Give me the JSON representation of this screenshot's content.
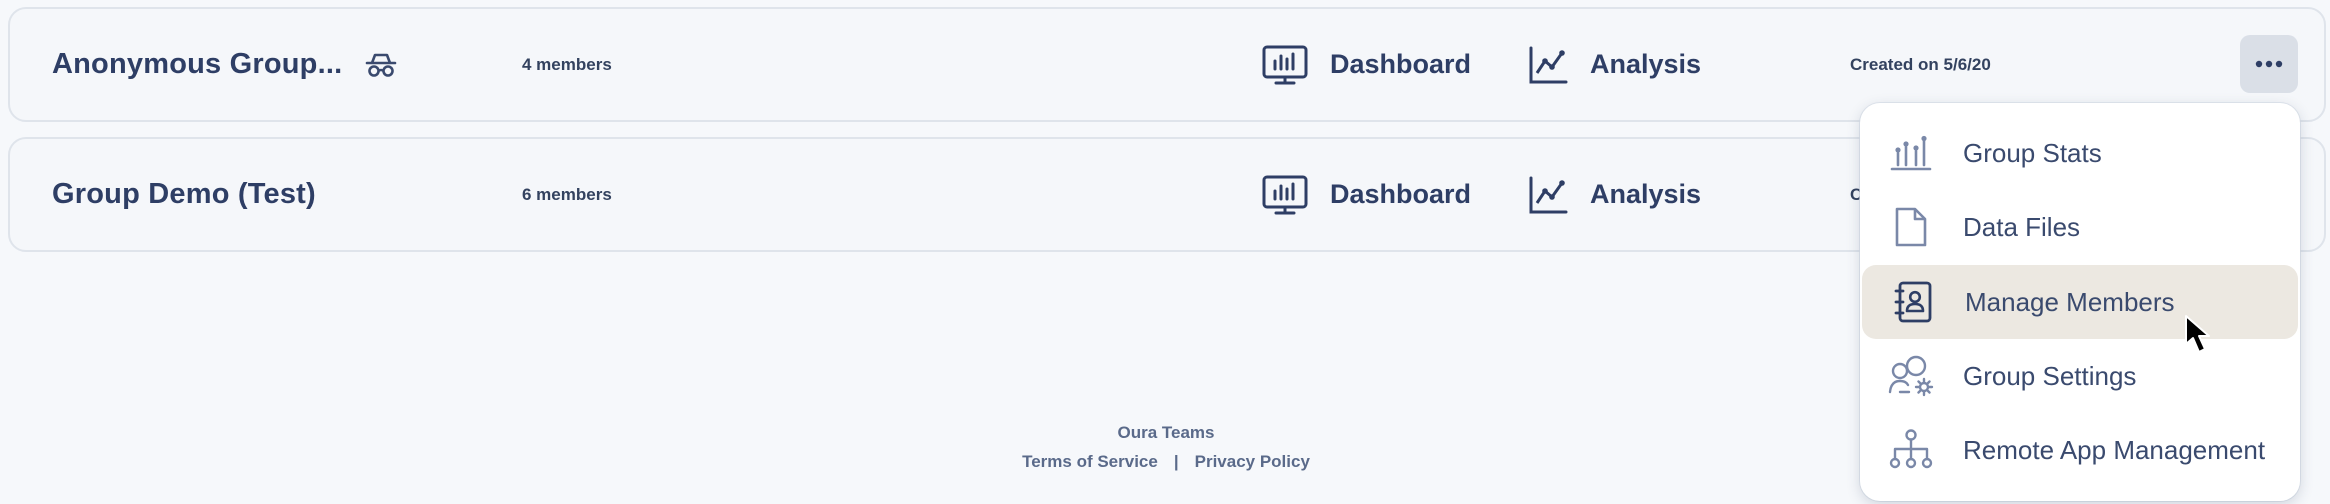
{
  "groups": [
    {
      "name": "Anonymous Group...",
      "icon": "incognito-icon",
      "members": "4 members",
      "dashboard_label": "Dashboard",
      "analysis_label": "Analysis",
      "created": "Created on 5/6/20"
    },
    {
      "name": "Group Demo (Test)",
      "members": "6 members",
      "dashboard_label": "Dashboard",
      "analysis_label": "Analysis",
      "created": "C"
    }
  ],
  "menu": {
    "items": [
      {
        "label": "Group Stats",
        "icon": "group-stats-icon"
      },
      {
        "label": "Data Files",
        "icon": "file-icon"
      },
      {
        "label": "Manage Members",
        "icon": "address-book-icon",
        "highlighted": true
      },
      {
        "label": "Group Settings",
        "icon": "group-settings-icon"
      },
      {
        "label": "Remote App Management",
        "icon": "network-icon"
      }
    ]
  },
  "footer": {
    "brand": "Oura Teams",
    "terms": "Terms of Service",
    "separator": "|",
    "privacy": "Privacy Policy"
  },
  "colors": {
    "background": "#f6f8fb",
    "text": "#2e3e65",
    "menu_highlight": "#ece8e1",
    "more_button_bg": "#dadfe7"
  }
}
